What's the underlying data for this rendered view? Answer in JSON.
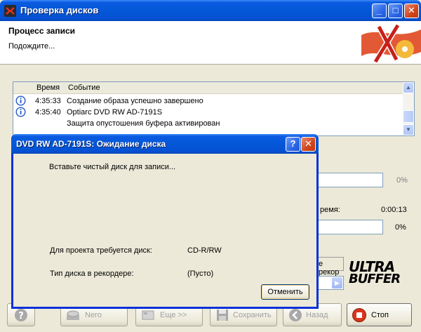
{
  "window": {
    "title": "Проверка дисков",
    "header_title": "Процесс записи",
    "header_subtitle": "Подождите..."
  },
  "log": {
    "columns": [
      "Время",
      "Событие"
    ],
    "rows": [
      {
        "time": "4:35:33",
        "event": "Создание образа успешно завершено",
        "icon": "info-icon"
      },
      {
        "time": "4:35:40",
        "event": "Optiarc DVD RW AD-7191S",
        "icon": "info-icon"
      },
      {
        "time": "",
        "event": "Защита опустошения буфера активирован",
        "icon": ""
      }
    ]
  },
  "background_panel": {
    "percent_1": "0%",
    "time_label": "ремя:",
    "time_value": "0:00:13",
    "percent_2": "0%",
    "combo_text": "е рекор"
  },
  "logo": {
    "ultra_line1": "ULTRA",
    "ultra_line2": "BUFFER"
  },
  "buttons": {
    "nero": "Nero",
    "more": "Еще >>",
    "save": "Сохранить",
    "back": "Назад",
    "stop": "Стоп"
  },
  "dialog": {
    "title": "DVD RW AD-7191S: Ожидание диска",
    "message": "Вставьте чистый диск для записи...",
    "required_label": "Для проекта требуется диск:",
    "required_value": "CD-R/RW",
    "type_label": "Тип диска в рекордере:",
    "type_value": "(Пусто)",
    "cancel_label": "Отменить"
  },
  "colors": {
    "titlebar": "#0458d8",
    "window_bg": "#ece9d8",
    "close_button": "#d0451c"
  }
}
